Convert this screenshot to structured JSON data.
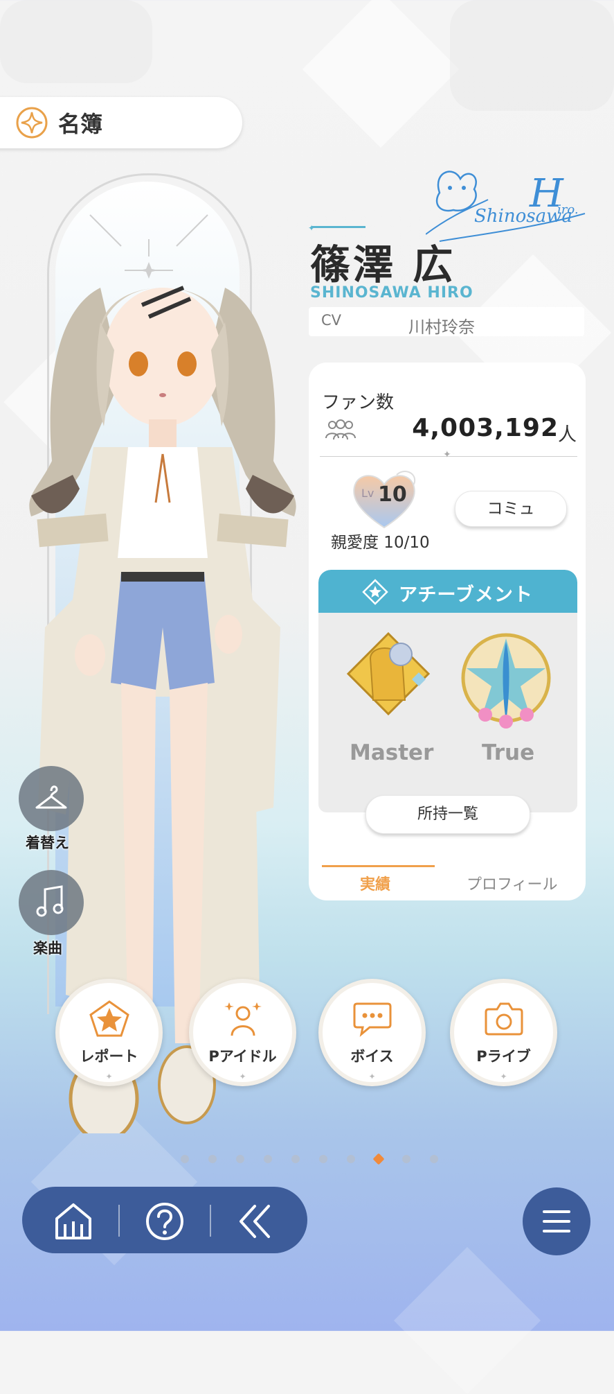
{
  "header": {
    "title": "名簿",
    "icon": "roster-emblem-icon"
  },
  "idol": {
    "name": "篠澤 広",
    "name_roman": "SHINOSAWA HIRO",
    "cv_label": "CV",
    "cv_name": "川村玲奈",
    "signature": "Shinosawa Hiro"
  },
  "stats": {
    "fan_label": "ファン数",
    "fan_count": "4,003,192",
    "fan_unit": "人",
    "affinity_level_prefix": "Lv",
    "affinity_level": "10",
    "affinity_text": "親愛度 10/10",
    "commu_button": "コミュ"
  },
  "achievement": {
    "title": "アチーブメント",
    "medals": [
      {
        "label": "Master",
        "icon": "master-medal-icon"
      },
      {
        "label": "True",
        "icon": "true-medal-icon"
      }
    ],
    "owned_button": "所持一覧"
  },
  "tabs": [
    {
      "label": "実績",
      "active": true
    },
    {
      "label": "プロフィール",
      "active": false
    }
  ],
  "side_buttons": [
    {
      "label": "着替え",
      "icon": "hanger-icon"
    },
    {
      "label": "楽曲",
      "icon": "music-note-icon"
    }
  ],
  "actions": [
    {
      "label": "レポート",
      "icon": "pentagon-star-icon"
    },
    {
      "label": "Pアイドル",
      "icon": "idol-person-icon"
    },
    {
      "label": "ボイス",
      "icon": "chat-bubble-icon"
    },
    {
      "label": "Pライブ",
      "icon": "camera-icon"
    }
  ],
  "pager": {
    "total": 10,
    "active_index": 7
  },
  "nav": {
    "items": [
      "home-icon",
      "help-icon",
      "back-icon"
    ],
    "menu": "hamburger-menu-icon"
  },
  "colors": {
    "accent_blue": "#4fb3d0",
    "accent_orange": "#f0a04b",
    "nav_blue": "#3d5c9a"
  }
}
